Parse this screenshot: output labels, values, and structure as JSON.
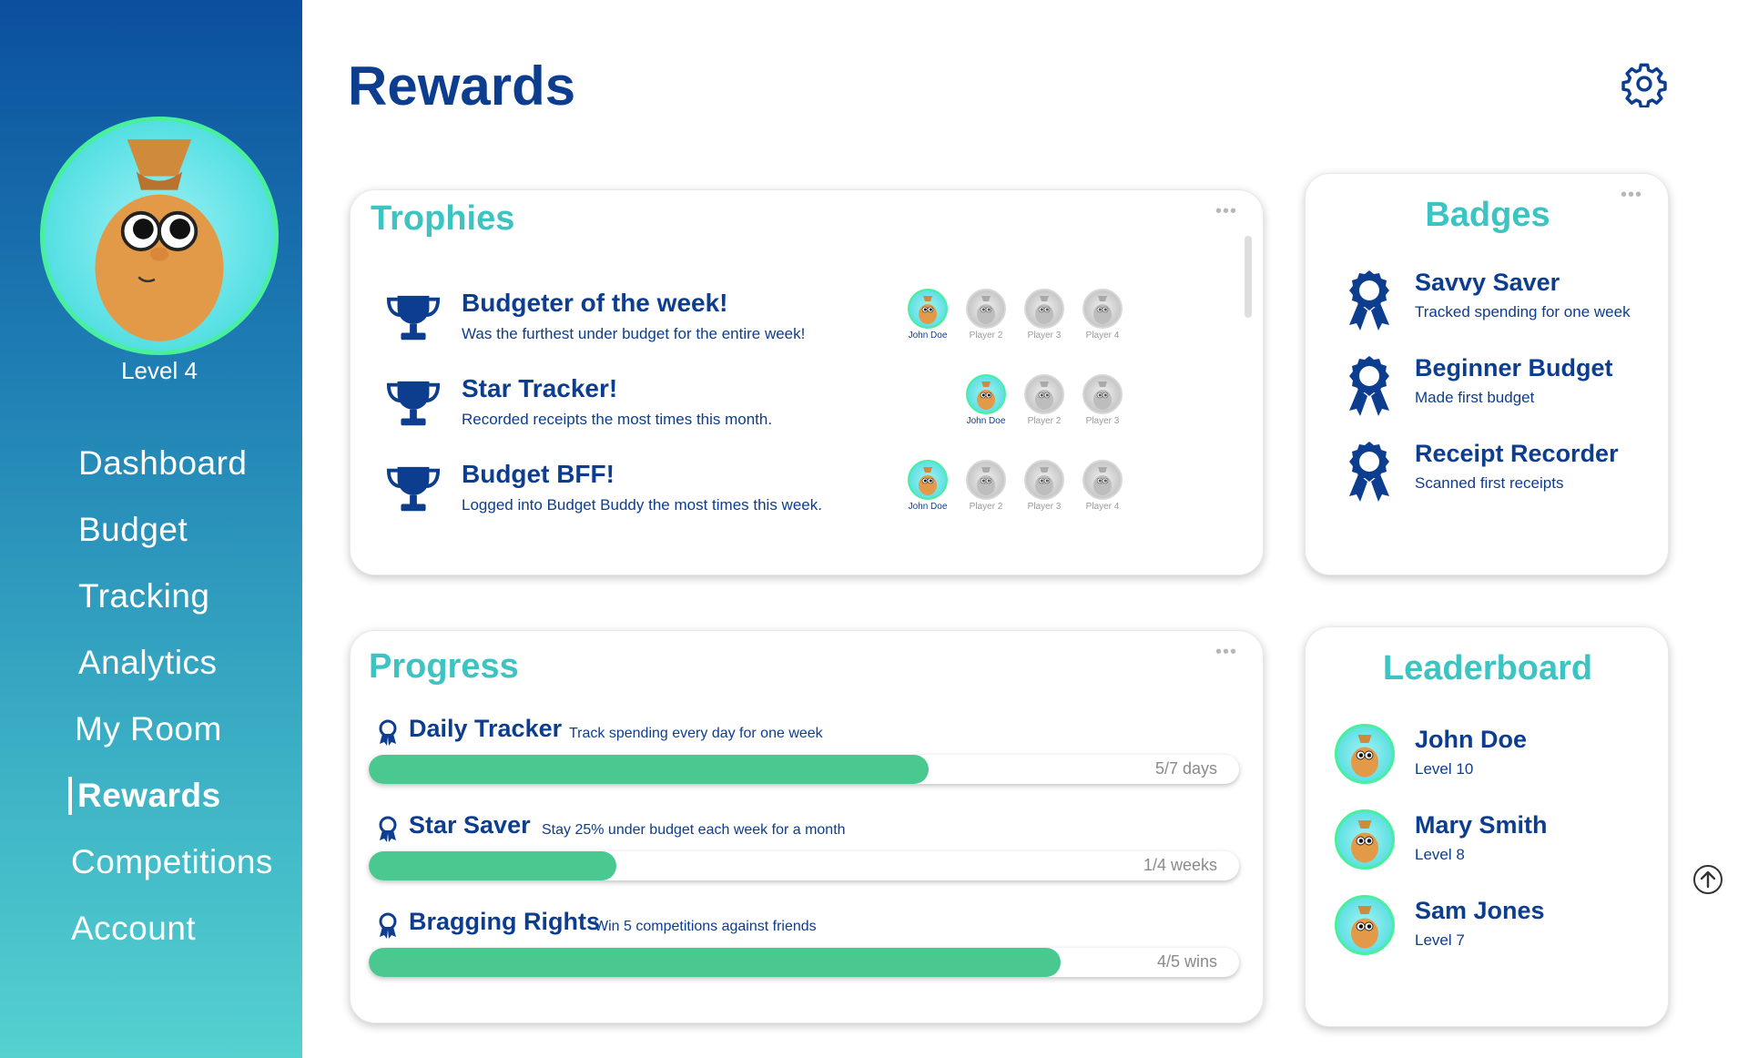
{
  "sidebar": {
    "level": "Level 4",
    "nav": [
      "Dashboard",
      "Budget",
      "Tracking",
      "Analytics",
      "My Room",
      "Rewards",
      "Competitions",
      "Account"
    ],
    "active": "Rewards"
  },
  "header": {
    "title": "Rewards",
    "settings_icon": "gear-icon"
  },
  "trophies": {
    "title": "Trophies",
    "menu": "•••",
    "items": [
      {
        "name": "Budgeter of the week!",
        "desc": "Was the furthest under budget for the entire week!",
        "players": [
          "John Doe",
          "Player 2",
          "Player 3",
          "Player 4"
        ]
      },
      {
        "name": "Star Tracker!",
        "desc": "Recorded receipts the most times this month.",
        "players": [
          "John Doe",
          "Player 2",
          "Player 3"
        ]
      },
      {
        "name": "Budget BFF!",
        "desc": "Logged into Budget Buddy the most times this week.",
        "players": [
          "John Doe",
          "Player 2",
          "Player 3",
          "Player 4"
        ]
      }
    ]
  },
  "badges": {
    "title": "Badges",
    "menu": "•••",
    "items": [
      {
        "name": "Savvy Saver",
        "desc": "Tracked spending for one week"
      },
      {
        "name": "Beginner Budget",
        "desc": "Made first budget"
      },
      {
        "name": "Receipt Recorder",
        "desc": "Scanned first receipts"
      }
    ]
  },
  "progress": {
    "title": "Progress",
    "menu": "•••",
    "items": [
      {
        "name": "Daily Tracker",
        "desc": "Track spending every day for one week",
        "label": "5/7 days",
        "fraction": 0.643
      },
      {
        "name": "Star Saver",
        "desc": "Stay 25% under budget each week for a month",
        "label": "1/4 weeks",
        "fraction": 0.285
      },
      {
        "name": "Bragging Rights",
        "desc": "Win 5 competitions against friends",
        "label": "4/5 wins",
        "fraction": 0.795
      }
    ]
  },
  "leaderboard": {
    "title": "Leaderboard",
    "items": [
      {
        "name": "John Doe",
        "level": "Level 10"
      },
      {
        "name": "Mary Smith",
        "level": "Level 8"
      },
      {
        "name": "Sam Jones",
        "level": "Level 7"
      }
    ]
  },
  "colors": {
    "navy": "#0d3d8f",
    "teal": "#3ec3c3",
    "progress_fill": "#49c98f"
  }
}
